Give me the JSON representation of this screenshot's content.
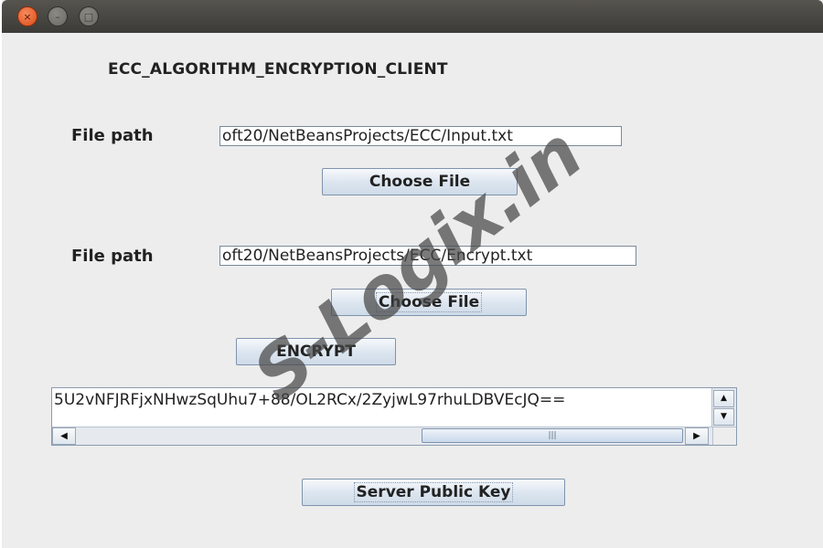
{
  "window": {
    "controls": [
      {
        "name": "close",
        "icon": "close-icon",
        "glyph": "×"
      },
      {
        "name": "minimize",
        "icon": "minimize-icon",
        "glyph": "–"
      },
      {
        "name": "maximize",
        "icon": "maximize-icon",
        "glyph": "□"
      }
    ]
  },
  "app": {
    "title": "ECC_ALGORITHM_ENCRYPTION_CLIENT"
  },
  "input_file": {
    "label": "File path",
    "value": "oft20/NetBeansProjects/ECC/Input.txt",
    "button_label": "Choose File"
  },
  "output_file": {
    "label": "File path",
    "value": "oft20/NetBeansProjects/ECC/Encrypt.txt",
    "button_label": "Choose File"
  },
  "encrypt": {
    "button_label": "ENCRYPT"
  },
  "output": {
    "text": "5U2vNFJRFjxNHwzSqUhu7+88/OL2RCx/2ZyjwL97rhuLDBVEcJQ==",
    "scroll_up_glyph": "▲",
    "scroll_down_glyph": "▼",
    "scroll_left_glyph": "◀",
    "scroll_right_glyph": "▶",
    "thumb_grip": "|||"
  },
  "server_key": {
    "button_label": "Server Public Key"
  },
  "watermark": {
    "text": "S-Logix.in"
  },
  "colors": {
    "window_bg": "#ededed",
    "titlebar": "#3c3b37",
    "close_button": "#df4a16",
    "button_gradient_bottom": "#cfdbe8",
    "button_border": "#7f93ad"
  }
}
